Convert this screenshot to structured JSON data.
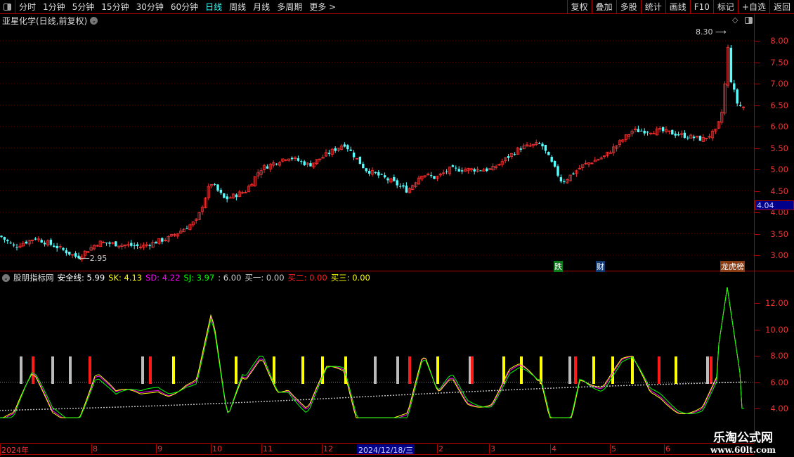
{
  "toolbar": {
    "periods": [
      "分时",
      "1分钟",
      "5分钟",
      "15分钟",
      "30分钟",
      "60分钟",
      "日线",
      "周线",
      "月线",
      "多周期",
      "更多 >"
    ],
    "active": "日线",
    "right_buttons": [
      "复权",
      "叠加",
      "多股",
      "统计",
      "画线",
      "F10",
      "标记",
      "+自选",
      "返回"
    ]
  },
  "chart_title": "亚星化学(日线,前复权)",
  "price_axis": {
    "labels": [
      "8.00",
      "7.50",
      "7.00",
      "6.50",
      "6.00",
      "5.50",
      "5.00",
      "4.50",
      "4.00",
      "3.50",
      "3.00"
    ],
    "current": "4.04"
  },
  "annotations": {
    "high": "8.30",
    "low": "2.95"
  },
  "badges": [
    {
      "text": "跌",
      "color": "#0a7a1a"
    },
    {
      "text": "财",
      "color": "#123a70"
    },
    {
      "text": "龙虎榜",
      "color": "#8a3a10"
    }
  ],
  "indicator": {
    "name": "股朋指标网",
    "legend": [
      {
        "label": "安全线:",
        "value": "5.99",
        "color": "#ffffff"
      },
      {
        "label": "SK:",
        "value": "4.13",
        "color": "#ffff00"
      },
      {
        "label": "SD:",
        "value": "4.22",
        "color": "#ff00ff"
      },
      {
        "label": "SJ:",
        "value": "3.97",
        "color": "#00ff00"
      },
      {
        "label": ":",
        "value": "6.00",
        "color": "#cccccc"
      },
      {
        "label": "买一:",
        "value": "0.00",
        "color": "#cccccc"
      },
      {
        "label": "买二:",
        "value": "0.00",
        "color": "#ff2020"
      },
      {
        "label": "买三:",
        "value": "0.00",
        "color": "#ffff00"
      }
    ],
    "axis_labels": [
      "12.00",
      "10.00",
      "8.00",
      "6.00",
      "4.00"
    ]
  },
  "date_axis": {
    "labels": [
      "2024年",
      "8",
      "9",
      "10",
      "11",
      "12",
      "2",
      "3",
      "4",
      "5",
      "6"
    ],
    "cursor": "2024/12/18/三"
  },
  "watermark": {
    "title": "乐淘公式网",
    "url": "www.60lt.com"
  },
  "chart_data": {
    "type": "candlestick",
    "price_path": [
      [
        0,
        3.45
      ],
      [
        20,
        3.2
      ],
      [
        50,
        3.4
      ],
      [
        80,
        3.2
      ],
      [
        110,
        2.95
      ],
      [
        140,
        3.3
      ],
      [
        200,
        3.2
      ],
      [
        240,
        3.4
      ],
      [
        280,
        3.8
      ],
      [
        300,
        4.7
      ],
      [
        320,
        4.3
      ],
      [
        350,
        4.5
      ],
      [
        370,
        5.0
      ],
      [
        410,
        5.3
      ],
      [
        440,
        5.1
      ],
      [
        490,
        5.6
      ],
      [
        520,
        5.0
      ],
      [
        560,
        4.7
      ],
      [
        580,
        4.5
      ],
      [
        600,
        4.9
      ],
      [
        620,
        4.8
      ],
      [
        640,
        5.0
      ],
      [
        700,
        5.0
      ],
      [
        740,
        5.5
      ],
      [
        770,
        5.6
      ],
      [
        800,
        4.7
      ],
      [
        830,
        5.1
      ],
      [
        860,
        5.3
      ],
      [
        900,
        5.9
      ],
      [
        940,
        5.9
      ],
      [
        1000,
        5.7
      ],
      [
        1020,
        5.9
      ],
      [
        1030,
        6.5
      ],
      [
        1035,
        8.0
      ],
      [
        1040,
        7.1
      ],
      [
        1050,
        6.5
      ],
      [
        1060,
        6.45
      ]
    ],
    "signals": [
      [
        30,
        "gray"
      ],
      [
        47,
        "red"
      ],
      [
        75,
        "gray"
      ],
      [
        100,
        "gray"
      ],
      [
        128,
        "red"
      ],
      [
        203,
        "gray"
      ],
      [
        214,
        "red"
      ],
      [
        247,
        "yellow"
      ],
      [
        336,
        "yellow"
      ],
      [
        390,
        "yellow"
      ],
      [
        431,
        "yellow"
      ],
      [
        459,
        "yellow"
      ],
      [
        492,
        "yellow"
      ],
      [
        534,
        "gray"
      ],
      [
        566,
        "gray"
      ],
      [
        583,
        "red"
      ],
      [
        623,
        "yellow"
      ],
      [
        669,
        "gray"
      ],
      [
        672,
        "red"
      ],
      [
        717,
        "yellow"
      ],
      [
        742,
        "yellow"
      ],
      [
        770,
        "yellow"
      ],
      [
        811,
        "gray"
      ],
      [
        819,
        "red"
      ],
      [
        845,
        "yellow"
      ],
      [
        872,
        "yellow"
      ],
      [
        900,
        "yellow"
      ],
      [
        938,
        "red"
      ],
      [
        962,
        "yellow"
      ],
      [
        1007,
        "gray"
      ],
      [
        1012,
        "red"
      ]
    ]
  }
}
